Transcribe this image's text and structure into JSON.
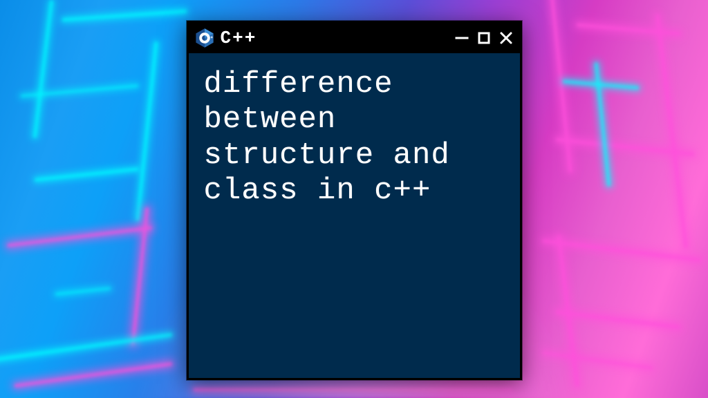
{
  "window": {
    "title": "C++",
    "icon": "cpp-logo-icon",
    "controls": {
      "minimize": "minimize-icon",
      "maximize": "maximize-icon",
      "close": "close-icon"
    }
  },
  "terminal": {
    "content": "difference between structure and class in c++"
  },
  "colors": {
    "terminal_bg": "#002b4d",
    "titlebar_bg": "#000000",
    "text": "#ffffff",
    "neon_cyan": "#00ffff",
    "neon_pink": "#ff50dc"
  }
}
